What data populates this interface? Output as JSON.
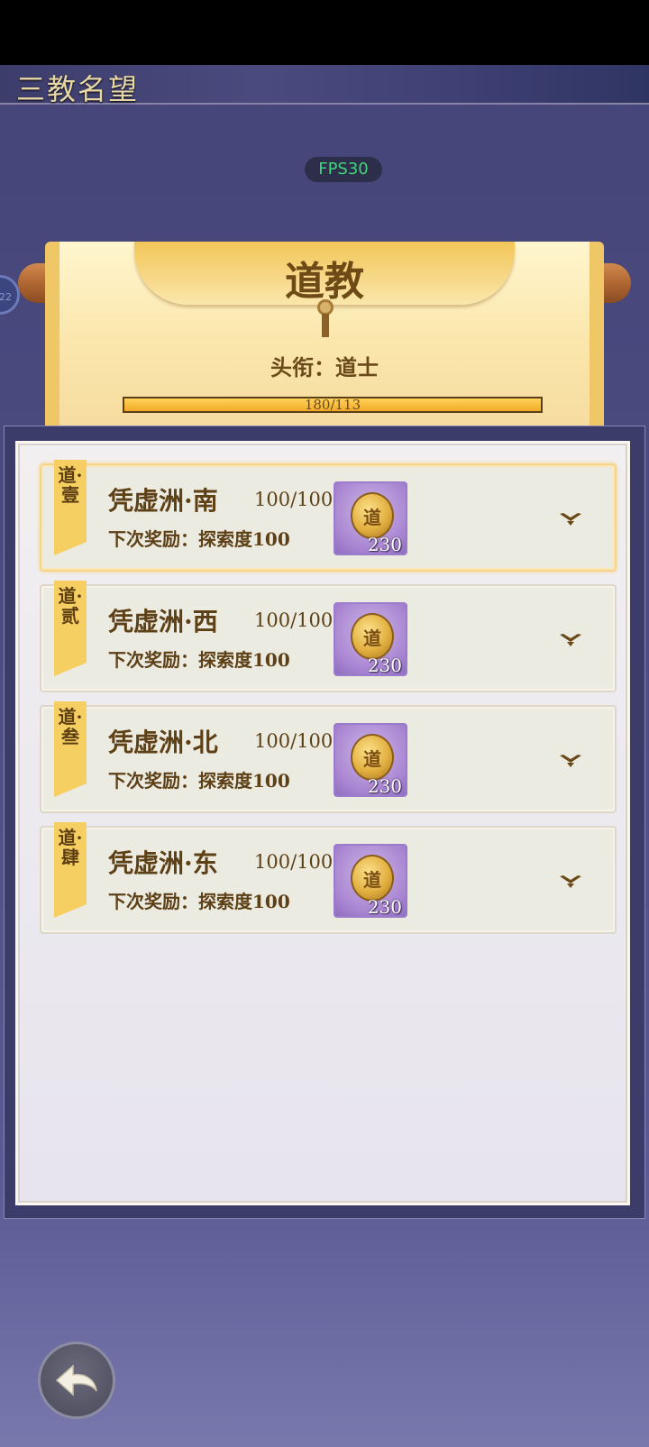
{
  "header": {
    "title": "三教名望"
  },
  "fps": {
    "label": "FPS30"
  },
  "side_badge": {
    "text": "22"
  },
  "scroll": {
    "school": "道教",
    "rank_label": "头衔：",
    "rank_value": "道士",
    "progress_text": "180/113",
    "progress_fraction": 1.0
  },
  "regions": [
    {
      "tag": "道·壹",
      "name": "凭虚洲·南",
      "progress": "100/100",
      "next_reward": "下次奖励：探索度100",
      "reward_icon_char": "道",
      "reward_count": "230",
      "active": true
    },
    {
      "tag": "道·贰",
      "name": "凭虚洲·西",
      "progress": "100/100",
      "next_reward": "下次奖励：探索度100",
      "reward_icon_char": "道",
      "reward_count": "230",
      "active": false
    },
    {
      "tag": "道·叁",
      "name": "凭虚洲·北",
      "progress": "100/100",
      "next_reward": "下次奖励：探索度100",
      "reward_icon_char": "道",
      "reward_count": "230",
      "active": false
    },
    {
      "tag": "道·肆",
      "name": "凭虚洲·东",
      "progress": "100/100",
      "next_reward": "下次奖励：探索度100",
      "reward_icon_char": "道",
      "reward_count": "230",
      "active": false
    }
  ],
  "icons": {
    "expand": "chevron-down-icon",
    "back": "back-arrow-icon",
    "reward": "dao-coin-icon"
  }
}
